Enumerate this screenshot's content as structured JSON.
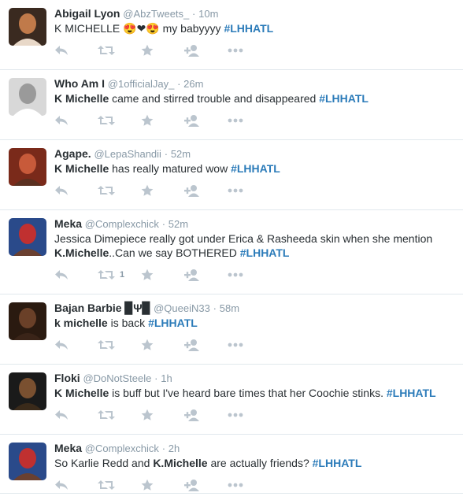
{
  "tweets": [
    {
      "fullname": "Abigail Lyon",
      "username": "@AbzTweets_",
      "sep": "·",
      "time": "10m",
      "text_parts": [
        {
          "t": "K MICHELLE ",
          "s": "plain"
        },
        {
          "t": "😍❤😍",
          "s": "emoji"
        },
        {
          "t": " my babyyyy ",
          "s": "plain"
        },
        {
          "t": "#LHHATL",
          "s": "hashtag"
        }
      ],
      "retweet_count": ""
    },
    {
      "fullname": "Who Am I",
      "username": "@1officialJay_",
      "sep": "·",
      "time": "26m",
      "text_parts": [
        {
          "t": "K Michelle",
          "s": "bold"
        },
        {
          "t": " came and stirred trouble and disappeared ",
          "s": "plain"
        },
        {
          "t": "#LHHATL",
          "s": "hashtag"
        }
      ],
      "retweet_count": ""
    },
    {
      "fullname": "Agape.",
      "username": "@LepaShandii",
      "sep": "·",
      "time": "52m",
      "text_parts": [
        {
          "t": "K Michelle",
          "s": "bold"
        },
        {
          "t": " has really matured wow ",
          "s": "plain"
        },
        {
          "t": "#LHHATL",
          "s": "hashtag"
        }
      ],
      "retweet_count": ""
    },
    {
      "fullname": "Meka",
      "username": "@Complexchick",
      "sep": "·",
      "time": "52m",
      "text_parts": [
        {
          "t": "Jessica Dimepiece really got under Erica & Rasheeda skin when she mention ",
          "s": "plain"
        },
        {
          "t": "K.Michelle",
          "s": "bold"
        },
        {
          "t": "..Can we say BOTHERED ",
          "s": "plain"
        },
        {
          "t": "#LHHATL",
          "s": "hashtag"
        }
      ],
      "retweet_count": "1"
    },
    {
      "fullname": "Bajan Barbie ▉Ψ▉",
      "username": "@QueeiN33",
      "sep": "·",
      "time": "58m",
      "text_parts": [
        {
          "t": "k michelle",
          "s": "bold"
        },
        {
          "t": " is back ",
          "s": "plain"
        },
        {
          "t": "#LHHATL",
          "s": "hashtag"
        }
      ],
      "retweet_count": ""
    },
    {
      "fullname": "Floki",
      "username": "@DoNotSteele",
      "sep": "·",
      "time": "1h",
      "text_parts": [
        {
          "t": "K Michelle",
          "s": "bold"
        },
        {
          "t": " is buff but I've heard bare times that her Coochie stinks. ",
          "s": "plain"
        },
        {
          "t": "#LHHATL",
          "s": "hashtag"
        }
      ],
      "retweet_count": ""
    },
    {
      "fullname": "Meka",
      "username": "@Complexchick",
      "sep": "·",
      "time": "2h",
      "text_parts": [
        {
          "t": "So Karlie Redd and ",
          "s": "plain"
        },
        {
          "t": "K.Michelle",
          "s": "bold"
        },
        {
          "t": " are actually friends? ",
          "s": "plain"
        },
        {
          "t": "#LHHATL",
          "s": "hashtag"
        }
      ],
      "retweet_count": ""
    }
  ],
  "icons": {
    "reply": "reply-icon",
    "retweet": "retweet-icon",
    "favorite": "star-icon",
    "follow": "follow-icon",
    "more": "more-icon"
  },
  "colors": {
    "hashtag": "#2b7bb9",
    "meta": "#8899a6",
    "action_icon": "#bbc5ce",
    "divider": "#e1e8ed"
  }
}
